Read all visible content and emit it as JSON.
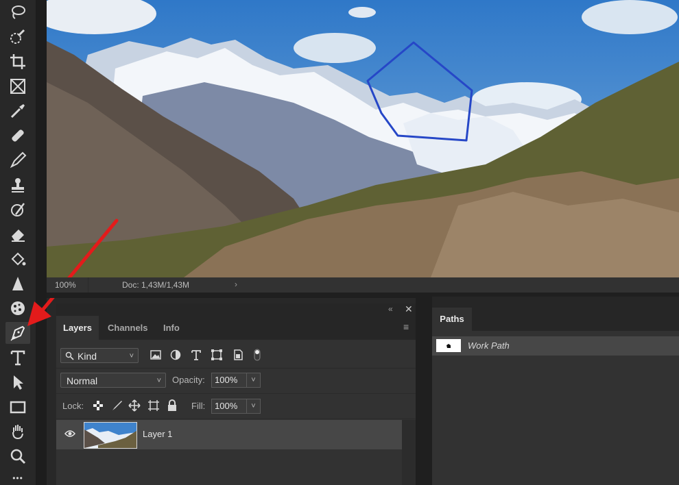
{
  "canvas": {
    "zoom": "100%",
    "doc_info": "Doc: 1,43M/1,43M",
    "arrow_glyph": "›"
  },
  "toolbar": {
    "tools": [
      {
        "name": "lasso-tool",
        "icon": "lasso-icon"
      },
      {
        "name": "quick-selection-tool",
        "icon": "quick-selection-icon"
      },
      {
        "name": "crop-tool",
        "icon": "crop-icon"
      },
      {
        "name": "frame-tool",
        "icon": "frame-icon"
      },
      {
        "name": "eyedropper-tool",
        "icon": "eyedropper-icon"
      },
      {
        "name": "healing-brush-tool",
        "icon": "bandage-icon"
      },
      {
        "name": "brush-tool",
        "icon": "brush-icon"
      },
      {
        "name": "clone-stamp-tool",
        "icon": "stamp-icon"
      },
      {
        "name": "history-brush-tool",
        "icon": "history-brush-icon"
      },
      {
        "name": "eraser-tool",
        "icon": "eraser-icon"
      },
      {
        "name": "paint-bucket-tool",
        "icon": "paint-bucket-icon"
      },
      {
        "name": "sharpen-tool",
        "icon": "triangle-icon"
      },
      {
        "name": "sponge-tool",
        "icon": "sponge-icon"
      },
      {
        "name": "pen-tool",
        "icon": "pen-icon",
        "active": true
      },
      {
        "name": "type-tool",
        "icon": "type-icon",
        "label": "T"
      },
      {
        "name": "path-selection-tool",
        "icon": "arrow-icon"
      },
      {
        "name": "rectangle-tool",
        "icon": "rectangle-icon"
      },
      {
        "name": "hand-tool",
        "icon": "hand-icon"
      },
      {
        "name": "zoom-tool",
        "icon": "magnifier-icon"
      },
      {
        "name": "more-tools",
        "icon": "ellipsis-icon",
        "label": "•••"
      }
    ],
    "highlight_color": "#e31b1b"
  },
  "layers_panel": {
    "collapse_glyph": "«",
    "close_glyph": "✕",
    "menu_glyph": "≡",
    "tabs": [
      "Layers",
      "Channels",
      "Info"
    ],
    "filter": {
      "label": "Kind",
      "chevron": "˅"
    },
    "blend_mode": {
      "label": "Normal",
      "chevron": "˅"
    },
    "opacity": {
      "label": "Opacity:",
      "value": "100%",
      "chevron": "˅"
    },
    "lock_label": "Lock:",
    "fill": {
      "label": "Fill:",
      "value": "100%",
      "chevron": "˅"
    },
    "layers": [
      {
        "name": "Layer 1",
        "visible": true
      }
    ]
  },
  "paths_panel": {
    "tab": "Paths",
    "paths": [
      {
        "name": "Work Path"
      }
    ]
  }
}
